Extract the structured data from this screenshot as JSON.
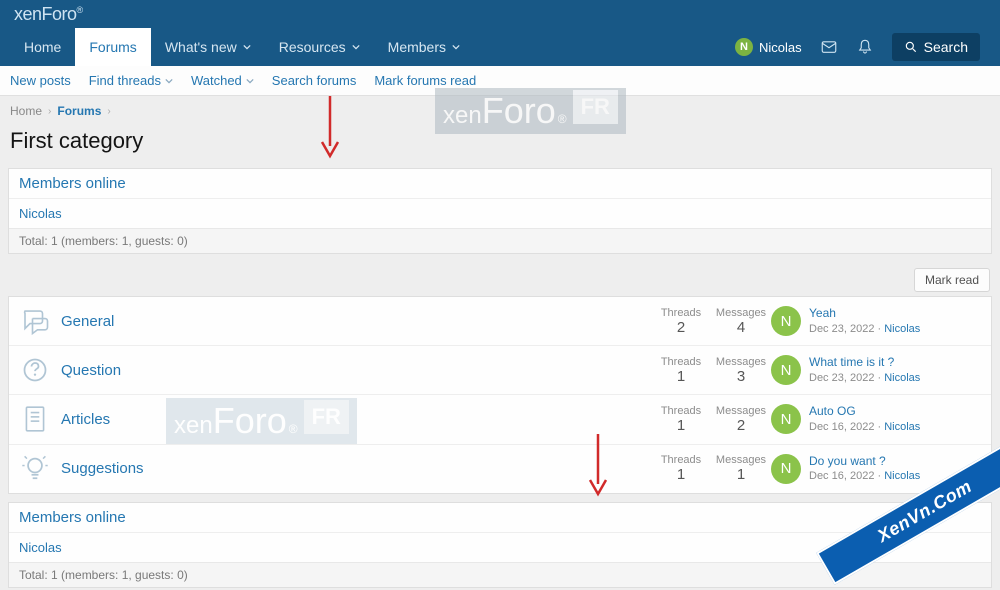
{
  "logo": "xenForo",
  "nav": {
    "tabs": [
      {
        "label": "Home"
      },
      {
        "label": "Forums",
        "active": true
      },
      {
        "label": "What's new",
        "chev": true
      },
      {
        "label": "Resources",
        "chev": true
      },
      {
        "label": "Members",
        "chev": true
      }
    ],
    "user": {
      "name": "Nicolas",
      "initial": "N"
    },
    "search_label": "Search"
  },
  "subnav": [
    {
      "label": "New posts"
    },
    {
      "label": "Find threads",
      "chev": true
    },
    {
      "label": "Watched",
      "chev": true
    },
    {
      "label": "Search forums"
    },
    {
      "label": "Mark forums read"
    }
  ],
  "breadcrumb": {
    "home": "Home",
    "current": "Forums"
  },
  "page_title": "First category",
  "widget": {
    "title": "Members online",
    "body": "Nicolas",
    "footer": "Total: 1 (members: 1, guests: 0)"
  },
  "mark_read_label": "Mark read",
  "labels": {
    "threads": "Threads",
    "messages": "Messages"
  },
  "forums": [
    {
      "name": "General",
      "threads": "2",
      "messages": "4",
      "latest": {
        "initial": "N",
        "title": "Yeah",
        "date": "Dec 23, 2022",
        "user": "Nicolas"
      }
    },
    {
      "name": "Question",
      "threads": "1",
      "messages": "3",
      "latest": {
        "initial": "N",
        "title": "What time is it ?",
        "date": "Dec 23, 2022",
        "user": "Nicolas"
      }
    },
    {
      "name": "Articles",
      "threads": "1",
      "messages": "2",
      "latest": {
        "initial": "N",
        "title": "Auto OG",
        "date": "Dec 16, 2022",
        "user": "Nicolas"
      }
    },
    {
      "name": "Suggestions",
      "threads": "1",
      "messages": "1",
      "latest": {
        "initial": "N",
        "title": "Do you want ?",
        "date": "Dec 16, 2022",
        "user": "Nicolas"
      }
    }
  ],
  "watermarks": {
    "xenforo_small": "xen",
    "xenforo_big": "Foro",
    "xenforo_fr": "FR"
  },
  "ribbon": "XenVn.Com"
}
